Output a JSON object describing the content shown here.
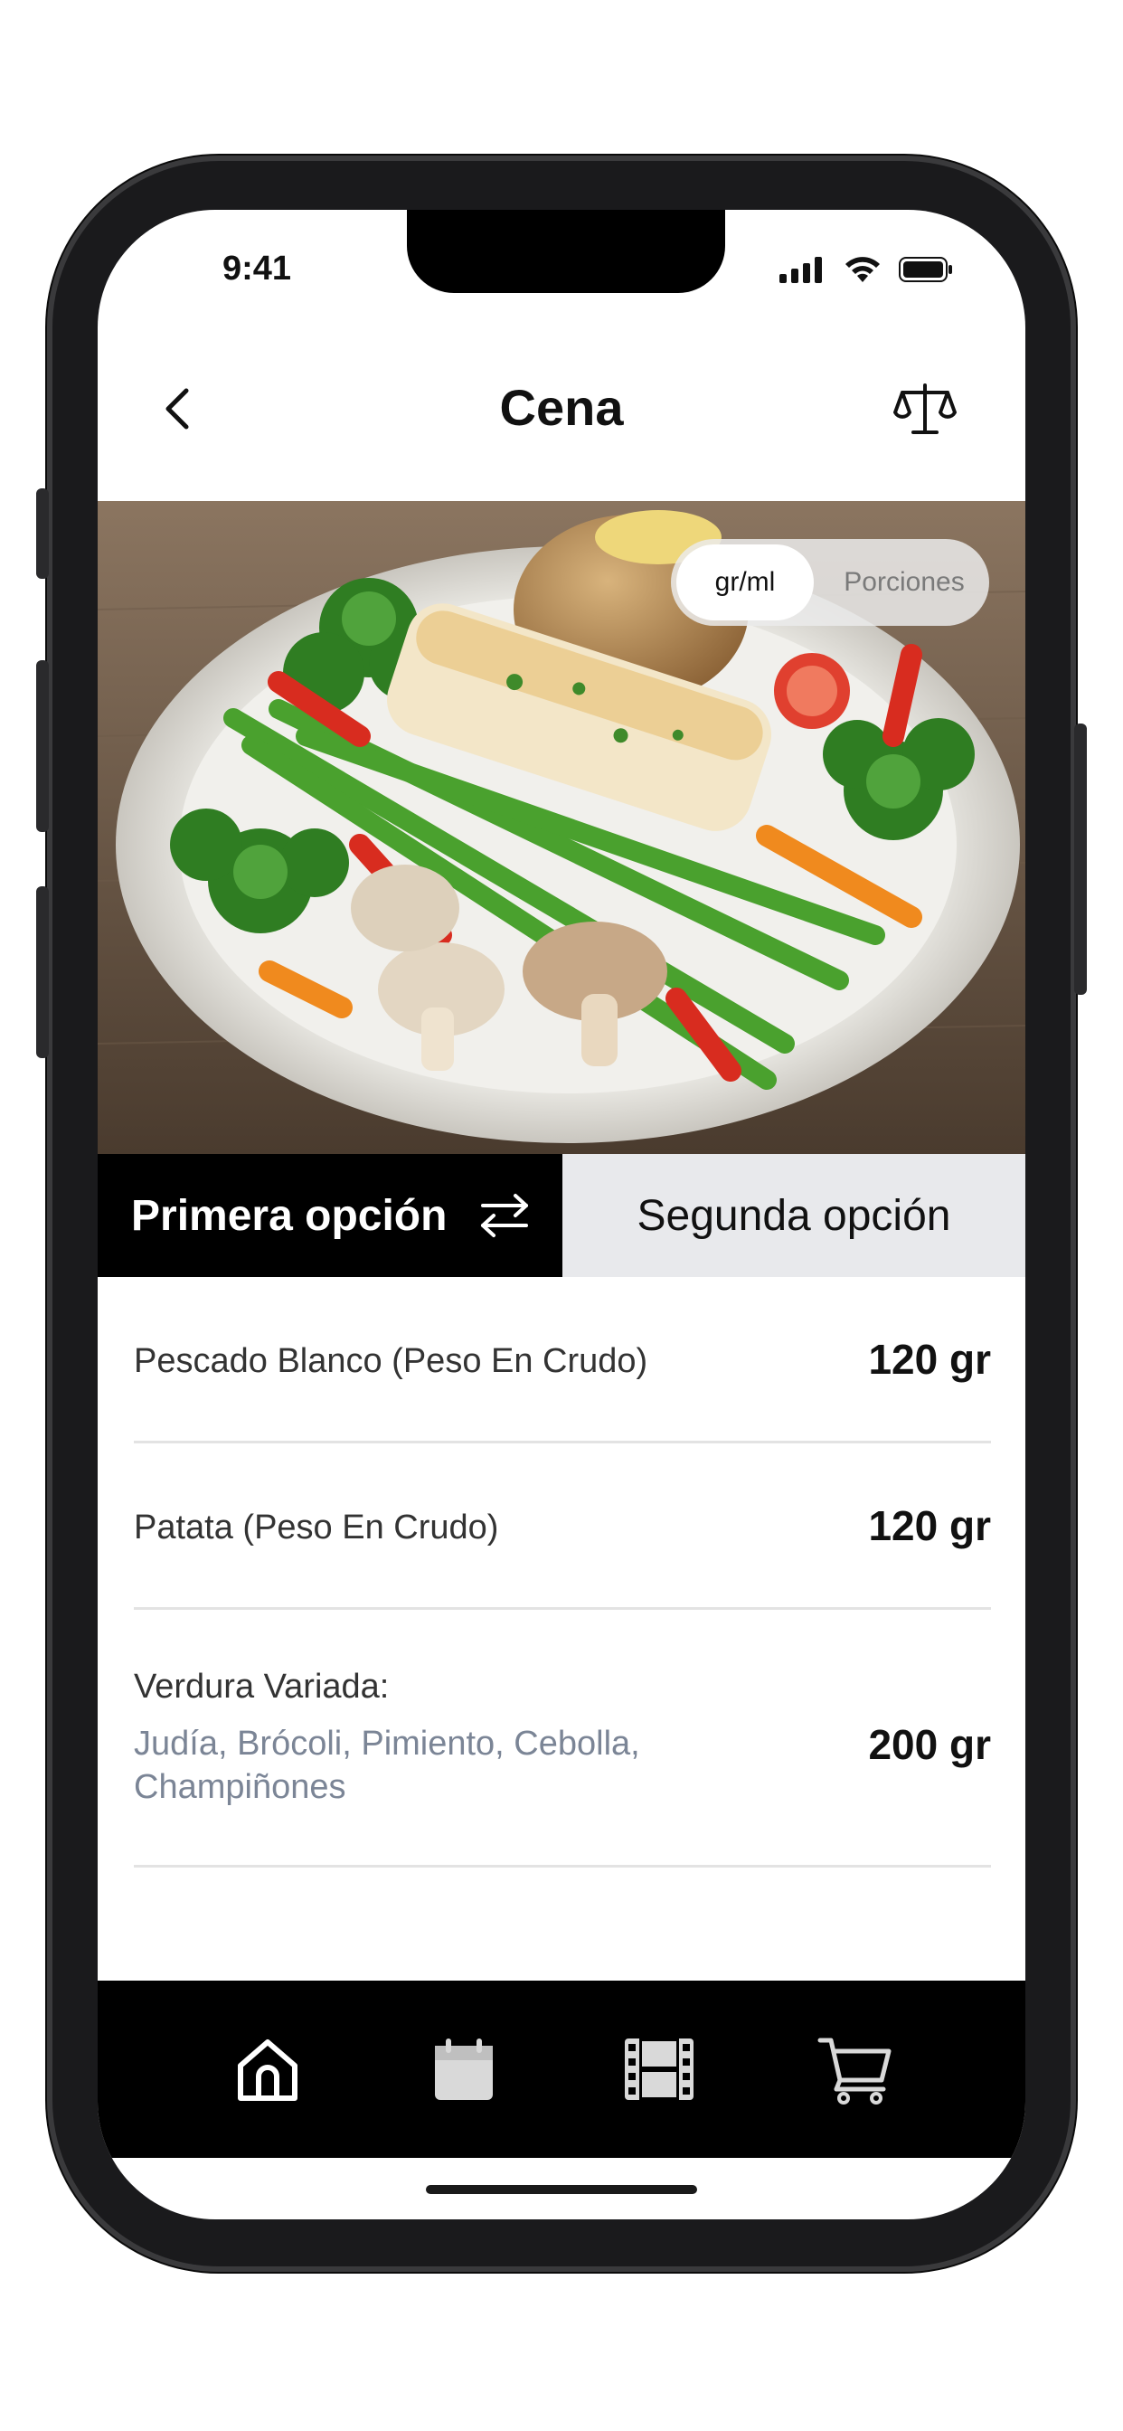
{
  "status_bar": {
    "time": "9:41",
    "icons": [
      "cellular-signal-icon",
      "wifi-icon",
      "battery-icon"
    ]
  },
  "header": {
    "title": "Cena",
    "back_icon": "chevron-left-icon",
    "scale_icon": "balance-scale-icon"
  },
  "hero": {
    "image": "plate-fish-vegetables-photo"
  },
  "unit_toggle": {
    "selected": "gr/ml",
    "other": "Porciones"
  },
  "options": {
    "first_label": "Primera opción",
    "swap_icon": "swap-arrows-icon",
    "second_label": "Segunda opción"
  },
  "ingredients": [
    {
      "name": "Pescado Blanco (Peso En Crudo)",
      "amount": "120 gr"
    },
    {
      "name": "Patata (Peso En Crudo)",
      "amount": "120 gr"
    },
    {
      "name": "Verdura Variada:",
      "detail": "Judía, Brócoli, Pimiento, Cebolla, Champiñones",
      "amount": "200 gr"
    }
  ],
  "tab_bar": {
    "items": [
      "home-icon",
      "calendar-icon",
      "film-icon",
      "shopping-cart-icon"
    ]
  },
  "colors": {
    "accent": "#000000",
    "inactive_tab_bg": "#e8e9ec",
    "subtext": "#7b8596"
  }
}
